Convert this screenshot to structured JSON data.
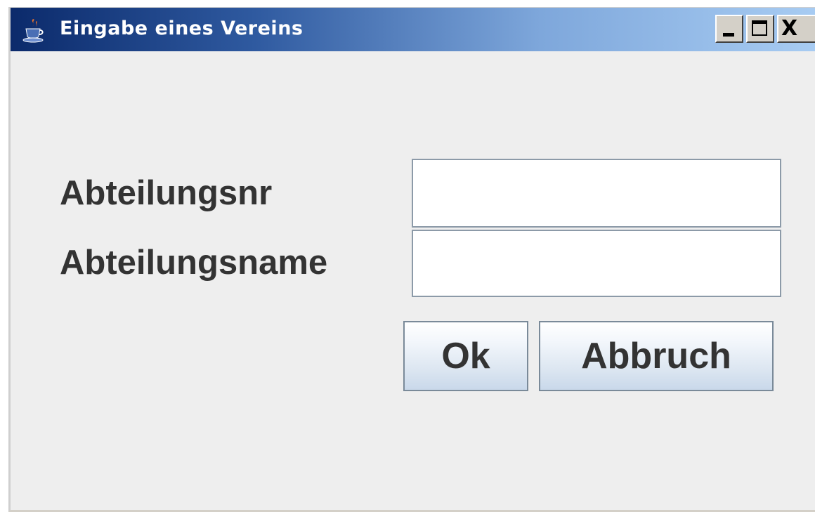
{
  "window": {
    "title": "Eingabe eines Vereins",
    "icon": "java-cup-icon",
    "controls": {
      "minimize_icon": "minimize-icon",
      "maximize_icon": "maximize-icon",
      "close_glyph": "X"
    }
  },
  "form": {
    "fields": [
      {
        "label": "Abteilungsnr",
        "value": ""
      },
      {
        "label": "Abteilungsname",
        "value": ""
      }
    ],
    "ok_label": "Ok",
    "cancel_label": "Abbruch"
  },
  "colors": {
    "titlebar_start": "#0b2a6b",
    "titlebar_end": "#a9cdf3",
    "window_bg": "#eeeeee",
    "label_text": "#333333",
    "button_border": "#7a8a99"
  }
}
